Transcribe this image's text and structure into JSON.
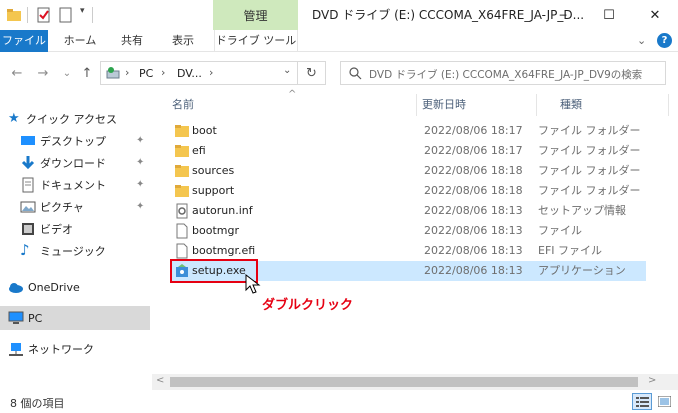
{
  "window": {
    "title": "DVD ドライブ (E:) CCCOMA_X64FRE_JA-JP_D...",
    "manage_tab": "管理",
    "minimize": "─",
    "maximize": "☐",
    "close": "✕"
  },
  "ribbon": {
    "tabs": [
      "ファイル",
      "ホーム",
      "共有",
      "表示",
      "ドライブ ツール"
    ],
    "expand_icon": "chevron-down-icon",
    "help_icon": "help-icon"
  },
  "address": {
    "back": "←",
    "forward": "→",
    "recent": "⌄",
    "up": "↑",
    "path_sep1": "›",
    "crumb_pc": "PC",
    "path_sep2": "›",
    "crumb_dv": "DV...",
    "path_sep3": "›",
    "dropdown": "⌄",
    "refresh": "↻",
    "search_placeholder": "DVD ドライブ (E:) CCCOMA_X64FRE_JA-JP_DV9の検索"
  },
  "nav": {
    "quick_access": "クイック アクセス",
    "items": [
      {
        "label": "デスクトップ",
        "pinned": true
      },
      {
        "label": "ダウンロード",
        "pinned": true
      },
      {
        "label": "ドキュメント",
        "pinned": true
      },
      {
        "label": "ピクチャ",
        "pinned": true
      },
      {
        "label": "ビデオ",
        "pinned": false
      },
      {
        "label": "ミュージック",
        "pinned": false
      }
    ],
    "pin_glyph": "📌",
    "onedrive": "OneDrive",
    "pc": "PC",
    "network": "ネットワーク"
  },
  "filelist": {
    "headers": {
      "name": "名前",
      "date": "更新日時",
      "type": "種類"
    },
    "sort_glyph": "^",
    "files": [
      {
        "name": "boot",
        "date": "2022/08/06 18:17",
        "type": "ファイル フォルダー",
        "icon": "folder-icon"
      },
      {
        "name": "efi",
        "date": "2022/08/06 18:17",
        "type": "ファイル フォルダー",
        "icon": "folder-icon"
      },
      {
        "name": "sources",
        "date": "2022/08/06 18:18",
        "type": "ファイル フォルダー",
        "icon": "folder-icon"
      },
      {
        "name": "support",
        "date": "2022/08/06 18:18",
        "type": "ファイル フォルダー",
        "icon": "folder-icon"
      },
      {
        "name": "autorun.inf",
        "date": "2022/08/06 18:13",
        "type": "セットアップ情報",
        "icon": "setup-info-icon"
      },
      {
        "name": "bootmgr",
        "date": "2022/08/06 18:13",
        "type": "ファイル",
        "icon": "file-icon"
      },
      {
        "name": "bootmgr.efi",
        "date": "2022/08/06 18:13",
        "type": "EFI ファイル",
        "icon": "file-icon"
      },
      {
        "name": "setup.exe",
        "date": "2022/08/06 18:13",
        "type": "アプリケーション",
        "icon": "setup-exe-icon",
        "selected": true
      }
    ]
  },
  "annotation": {
    "label": "ダブルクリック",
    "color": "#e60012"
  },
  "scroll": {
    "left": "<",
    "right": ">"
  },
  "status": {
    "item_count": "8 個の項目"
  },
  "colors": {
    "accent": "#1979ca",
    "manage_tab": "#cfe9bd",
    "selection": "#cce8ff",
    "folder": "#f4c64f"
  }
}
